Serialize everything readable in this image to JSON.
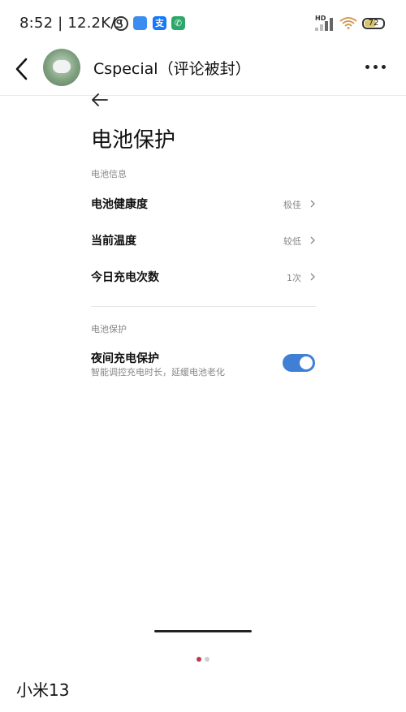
{
  "status_bar": {
    "time_speed": "8:52 | 12.2K/s",
    "hd_label": "HD",
    "battery_level": "72"
  },
  "chat_header": {
    "title": "Cspecial（评论被封）"
  },
  "settings": {
    "page_title": "电池保护",
    "section1_label": "电池信息",
    "rows": [
      {
        "label": "电池健康度",
        "value": "极佳"
      },
      {
        "label": "当前温度",
        "value": "较低"
      },
      {
        "label": "今日充电次数",
        "value": "1次"
      }
    ],
    "section2_label": "电池保护",
    "toggle": {
      "title": "夜间充电保护",
      "subtitle": "智能调控充电时长，延缓电池老化",
      "state": "on"
    }
  },
  "pager": {
    "active_dot_color": "#c0394a",
    "inactive_dot_color": "#cfcfcf"
  },
  "caption": "小米13",
  "colors": {
    "toggle_on": "#3f7fd6"
  }
}
